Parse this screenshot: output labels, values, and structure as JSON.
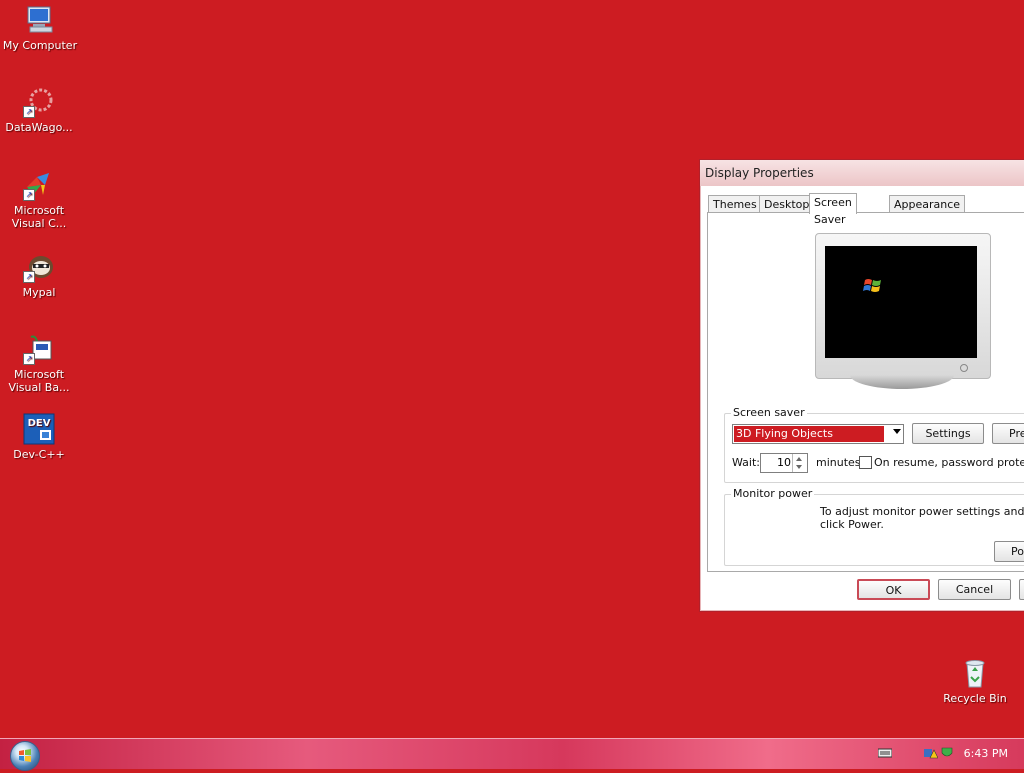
{
  "desktop": {
    "icons": [
      {
        "label": "My Computer",
        "icon": "my-computer-icon"
      },
      {
        "label": "DataWago...",
        "icon": "datawagon-shortcut-icon"
      },
      {
        "label": "Microsoft\nVisual C...",
        "icon": "visual-cpp-shortcut-icon"
      },
      {
        "label": "Mypal",
        "icon": "mypal-shortcut-icon"
      },
      {
        "label": "Microsoft\nVisual Ba...",
        "icon": "visual-basic-shortcut-icon"
      },
      {
        "label": "Dev-C++",
        "icon": "dev-cpp-icon"
      },
      {
        "label": "Recycle Bin",
        "icon": "recycle-bin-icon"
      }
    ],
    "background_color": "#cd1c22"
  },
  "dialog": {
    "title": "Display Properties",
    "tabs": [
      {
        "label": "Themes"
      },
      {
        "label": "Desktop"
      },
      {
        "label": "Screen Saver",
        "active": true
      },
      {
        "label": "Appearance"
      }
    ],
    "screen_saver": {
      "group_label": "Screen saver",
      "selected": "3D Flying Objects",
      "settings_label": "Settings",
      "preview_label": "Pre",
      "wait_label": "Wait:",
      "wait_value": "10",
      "minutes_label": "minutes",
      "password_label": "On resume, password protect"
    },
    "monitor_power": {
      "group_label": "Monitor power",
      "description_line1": "To adjust monitor power settings and save e",
      "description_line2": "click Power.",
      "power_label": "Po"
    },
    "buttons": {
      "ok": "OK",
      "cancel": "Cancel"
    }
  },
  "taskbar": {
    "clock": "6:43 PM"
  }
}
